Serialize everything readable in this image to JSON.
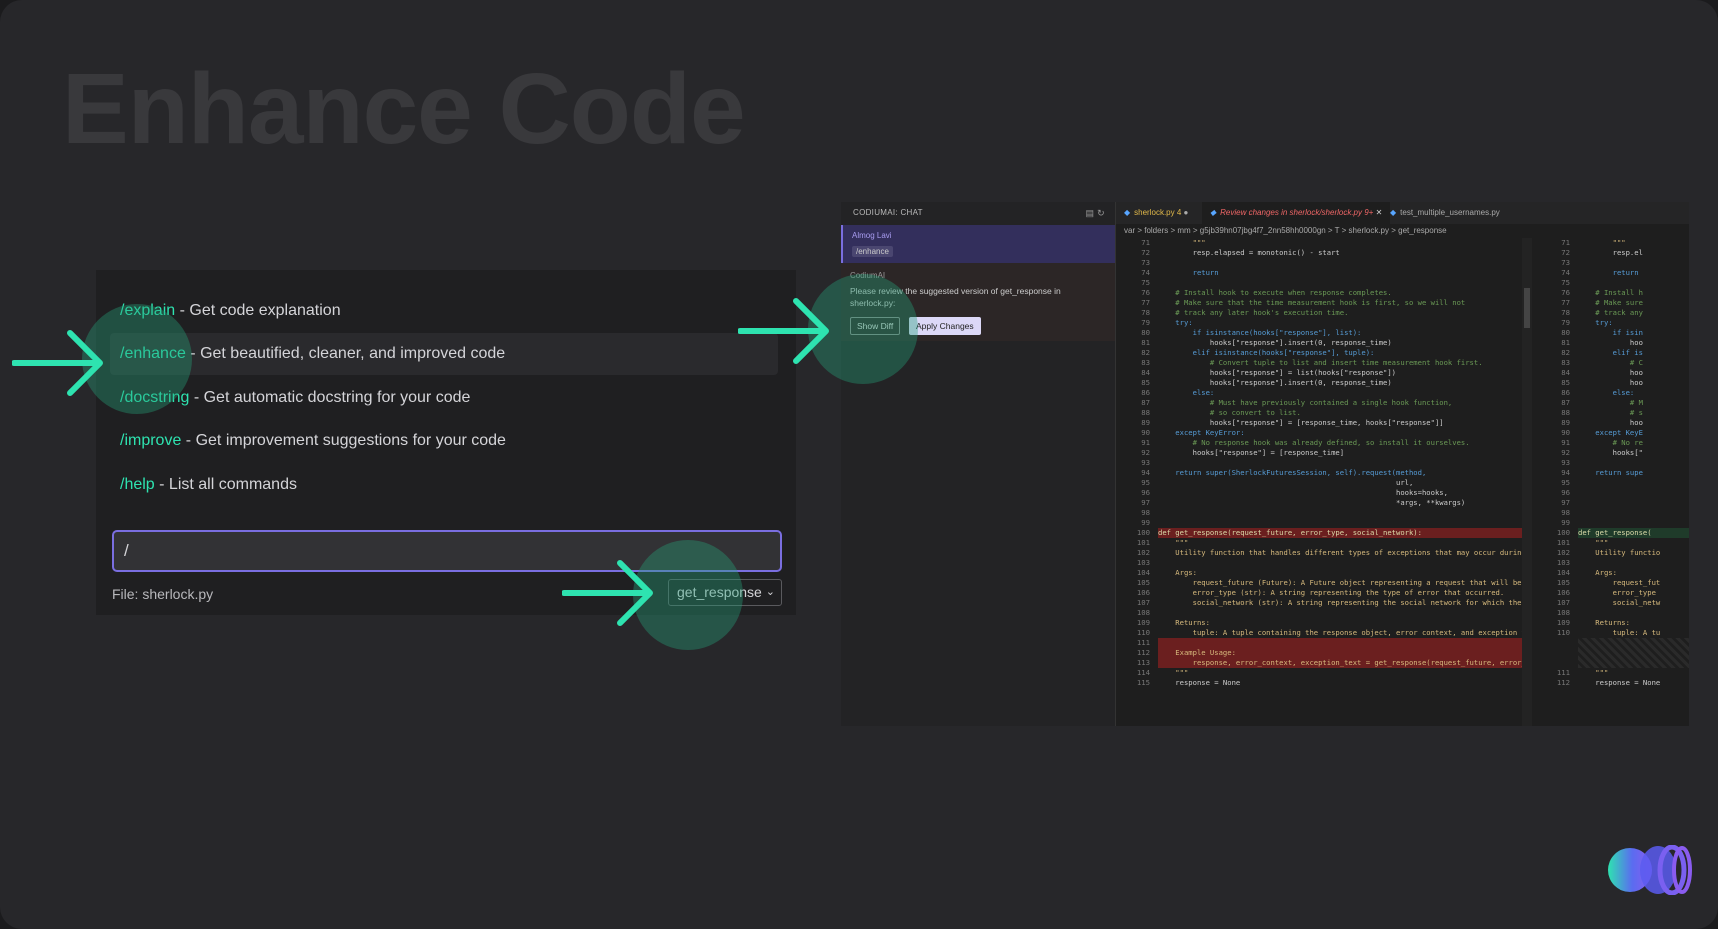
{
  "slide": {
    "title": "Enhance Code"
  },
  "commands": [
    {
      "keyword": "/explain",
      "desc": " - Get code explanation"
    },
    {
      "keyword": "/enhance",
      "desc": " - Get beautified, cleaner, and improved code"
    },
    {
      "keyword": "/docstring",
      "desc": " - Get automatic docstring for your code"
    },
    {
      "keyword": "/improve",
      "desc": " - Get improvement suggestions for your code"
    },
    {
      "keyword": "/help",
      "desc": " - List all commands"
    }
  ],
  "input": {
    "value": "/"
  },
  "file": {
    "label": "File: sherlock.py"
  },
  "function_select": {
    "value": "get_response"
  },
  "chat": {
    "header": "CODIUMAI: CHAT",
    "user_name": "Almog Lavi",
    "user_command": "/enhance",
    "bot_name": "CodiumAI",
    "bot_text": "Please review the suggested version of get_response in sherlock.py:",
    "show_diff": "Show Diff",
    "apply_changes": "Apply Changes"
  },
  "editor": {
    "tabs": [
      "sherlock.py 4",
      "Review changes in sherlock/sherlock.py 9+",
      "test_multiple_usernames.py"
    ],
    "breadcrumb": "var > folders > mm > g5jb39hn07jbg4f7_2nn58hh0000gn > T > sherlock.py > get_response",
    "left_line_numbers": [
      "71",
      "72",
      "73",
      "74",
      "75",
      "76",
      "77",
      "78",
      "79",
      "80",
      "81",
      "82",
      "83",
      "84",
      "85",
      "86",
      "87",
      "88",
      "89",
      "90",
      "91",
      "92",
      "93",
      "94",
      "95",
      "96",
      "97",
      "98",
      "99",
      "100",
      "101",
      "102",
      "103",
      "104",
      "105",
      "106",
      "107",
      "108",
      "109",
      "110",
      "111",
      "112",
      "113",
      "114",
      "115"
    ],
    "right_line_numbers": [
      "71",
      "72",
      "73",
      "74",
      "75",
      "76",
      "77",
      "78",
      "79",
      "80",
      "81",
      "82",
      "83",
      "84",
      "85",
      "86",
      "87",
      "88",
      "89",
      "90",
      "91",
      "92",
      "93",
      "94",
      "95",
      "96",
      "97",
      "98",
      "99",
      "100",
      "101",
      "102",
      "103",
      "104",
      "105",
      "106",
      "107",
      "108",
      "109",
      "110",
      "",
      "",
      "",
      "111",
      "112"
    ],
    "left_code": [
      "        \"\"\"",
      "        resp.elapsed = monotonic() - start",
      "",
      "        return",
      "",
      "    # Install hook to execute when response completes.",
      "    # Make sure that the time measurement hook is first, so we will not",
      "    # track any later hook's execution time.",
      "    try:",
      "        if isinstance(hooks[\"response\"], list):",
      "            hooks[\"response\"].insert(0, response_time)",
      "        elif isinstance(hooks[\"response\"], tuple):",
      "            # Convert tuple to list and insert time measurement hook first.",
      "            hooks[\"response\"] = list(hooks[\"response\"])",
      "            hooks[\"response\"].insert(0, response_time)",
      "        else:",
      "            # Must have previously contained a single hook function,",
      "            # so convert to list.",
      "            hooks[\"response\"] = [response_time, hooks[\"response\"]]",
      "    except KeyError:",
      "        # No response hook was already defined, so install it ourselves.",
      "        hooks[\"response\"] = [response_time]",
      "",
      "    return super(SherlockFuturesSession, self).request(method,",
      "                                                       url,",
      "                                                       hooks=hooks,",
      "                                                       *args, **kwargs)",
      "",
      "",
      "def get_response(request_future, error_type, social_network):",
      "    \"\"\"",
      "    Utility function that handles different types of exceptions that may occur during the e",
      "",
      "    Args:",
      "        request_future (Future): A Future object representing a request that will be execut",
      "        error_type (str): A string representing the type of error that occurred.",
      "        social_network (str): A string representing the social network for which the reques",
      "",
      "    Returns:",
      "        tuple: A tuple containing the response object, error context, and exception text.",
      "",
      "    Example Usage:",
      "        response, error_context, exception_text = get_response(request_future, error_type,",
      "    \"\"\"",
      "    response = None"
    ],
    "right_code": [
      "        \"\"\"",
      "        resp.el",
      "",
      "        return",
      "",
      "    # Install h",
      "    # Make sure",
      "    # track any",
      "    try:",
      "        if isin",
      "            hoo",
      "        elif is",
      "            # C",
      "            hoo",
      "            hoo",
      "        else:",
      "            # M",
      "            # s",
      "            hoo",
      "    except KeyE",
      "        # No re",
      "        hooks[\"",
      "",
      "    return supe",
      "",
      "",
      "",
      "",
      "",
      "def get_response(",
      "    \"\"\"",
      "    Utility functio",
      "",
      "    Args:",
      "        request_fut",
      "        error_type",
      "        social_netw",
      "",
      "    Returns:",
      "        tuple: A tu",
      "",
      "",
      "",
      "    \"\"\"",
      "    response = None"
    ]
  },
  "colors": {
    "accent": "#2ee3b0",
    "input_border": "#7a6ee0",
    "background": "#27272a"
  }
}
